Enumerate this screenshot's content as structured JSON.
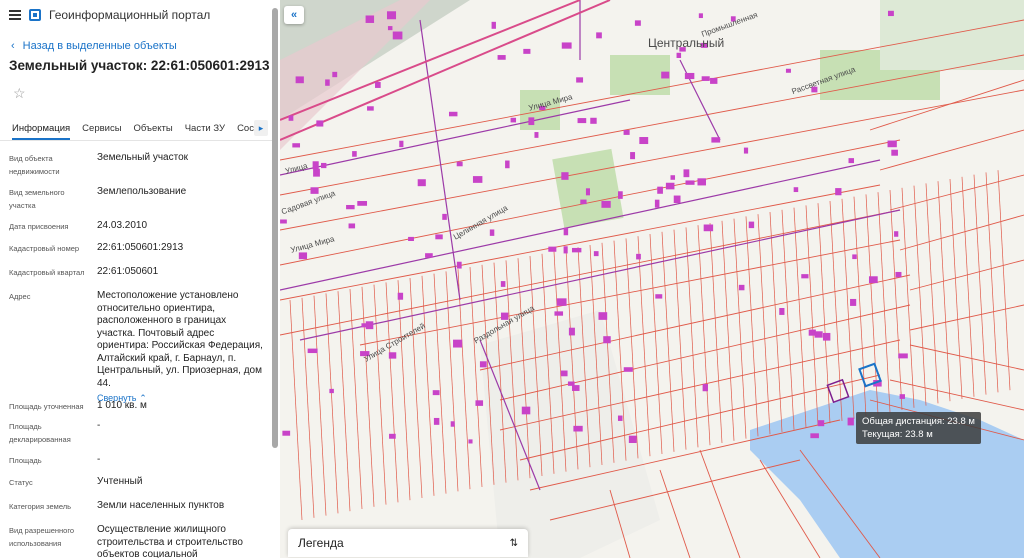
{
  "header": {
    "portal_title": "Геоинформационный портал"
  },
  "nav": {
    "back_label": "Назад в выделенные объекты"
  },
  "object": {
    "title": "Земельный участок: 22:61:050601:2913"
  },
  "tabs": [
    "Информация",
    "Сервисы",
    "Объекты",
    "Части ЗУ",
    "Соста"
  ],
  "fields": [
    {
      "label": "Вид объекта недвижимости",
      "value": "Земельный участок"
    },
    {
      "label": "Вид земельного участка",
      "value": "Землепользование"
    },
    {
      "label": "Дата присвоения",
      "value": "24.03.2010"
    },
    {
      "label": "Кадастровый номер",
      "value": "22:61:050601:2913"
    },
    {
      "label": "Кадастровый квартал",
      "value": "22:61:050601"
    },
    {
      "label": "Адрес",
      "value": "Местоположение установлено относительно ориентира, расположенного в границах участка. Почтовый адрес ориентира: Российская Федерация, Алтайский край, г. Барнаул, п. Центральный, ул. Приозерная, дом 44."
    },
    {
      "label": "Площадь уточненная",
      "value": "1 010 кв. м"
    },
    {
      "label": "Площадь декларированная",
      "value": "-"
    },
    {
      "label": "Площадь",
      "value": "-"
    },
    {
      "label": "Статус",
      "value": "Учтенный"
    },
    {
      "label": "Категория земель",
      "value": "Земли населенных пунктов"
    },
    {
      "label": "Вид разрешенного использования",
      "value": "Осуществление жилищного строительства и строительство объектов социальной"
    }
  ],
  "collapse_label": "Свернуть",
  "map": {
    "legend_label": "Легенда",
    "tooltip_total": "Общая дистанция: 23.8 м",
    "tooltip_current": "Текущая: 23.8 м",
    "place_label": "Центральный",
    "street_labels": [
      "Улица Мира",
      "Улица Мира",
      "Целинная улица",
      "Раздольная улица",
      "Улица Строителей",
      "Садовая улица",
      "Рассветная улица",
      "Промышленная",
      "Улица"
    ]
  },
  "colors": {
    "accent": "#1a73c8",
    "parcel": "#e05a4a",
    "building": "#c843c8",
    "water": "#aacdf2",
    "green": "#c7e0b4"
  },
  "icons": {
    "menu": "menu-icon",
    "logo": "portal-logo-icon",
    "back": "chevron-left-icon",
    "star": "star-icon",
    "collapse": "double-chevron-left-icon",
    "legend": "chevron-updown-icon"
  }
}
